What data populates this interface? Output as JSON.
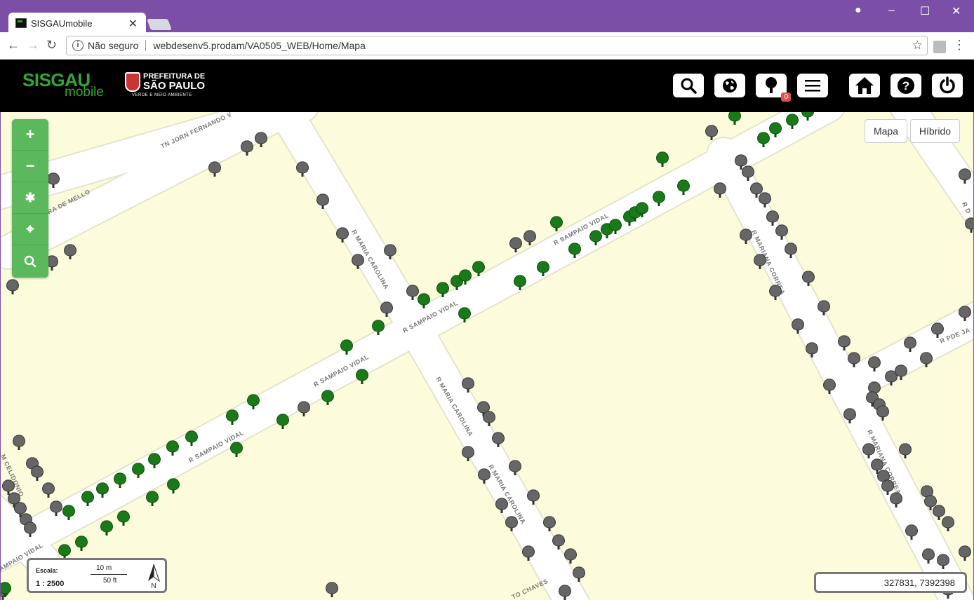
{
  "browser": {
    "tab_title": "SISGAUmobile",
    "security": "Não seguro",
    "url": "webdesenv5.prodam/VA0505_WEB/Home/Mapa"
  },
  "app": {
    "logo_main": "SISGAU",
    "logo_sub": "mobile",
    "prefeitura_line1": "PREFEITURA DE",
    "prefeitura_line2": "SÃO PAULO",
    "prefeitura_line3": "VERDE E MEIO AMBIENTE",
    "tree_count": "0",
    "buttons": [
      "search-icon",
      "globe-icon",
      "tree-icon",
      "menu-icon",
      "home-icon",
      "help-icon",
      "power-icon"
    ]
  },
  "map": {
    "layer_buttons": [
      "Mapa",
      "Híbrido"
    ],
    "zoom_controls": [
      "plus-icon",
      "minus-icon",
      "extent-icon",
      "locate-icon",
      "search-icon"
    ],
    "streets": [
      "TN JORN FERNANDO V",
      "EIRA DE MELLO",
      "R MARIA CAROLINA",
      "R SAMPAIO VIDAL",
      "R MARIANA CORREA",
      "R PDE JA",
      "M CELIDONIO",
      "AMPAIO VIDAL",
      "TO CHAVES",
      "R D"
    ],
    "scale_label": "Escala:",
    "scale_value": "1 : 2500",
    "scale_metric": "10 m",
    "scale_imperial": "50 ft",
    "north_label": "N",
    "coordinates": "327831, 7392398",
    "colors": {
      "road": "#ffffff",
      "land": "#fcfcdc",
      "tree_active": "#1a7a1a",
      "tree_other": "#666666",
      "accent": "#5cb85c"
    }
  }
}
